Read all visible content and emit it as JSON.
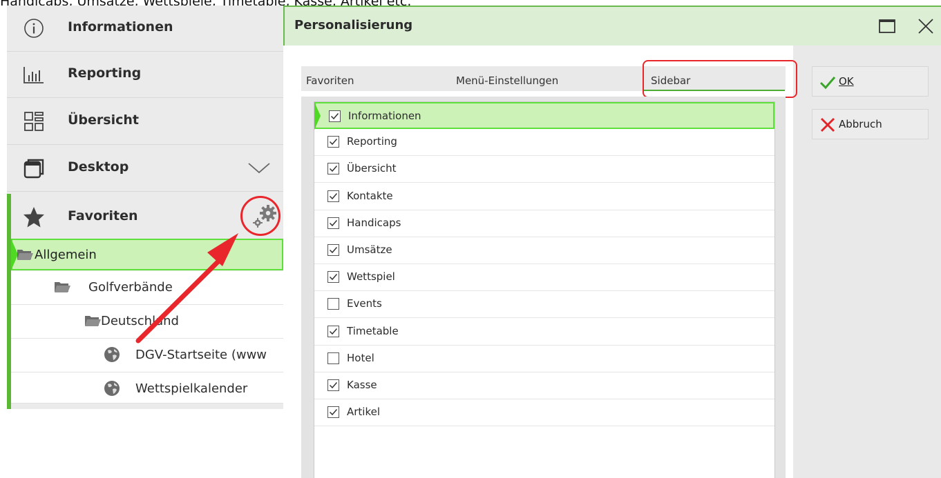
{
  "caption": "Handicaps, Umsätze, Wettspiele, Timetable, Kasse, Artikel etc.",
  "sidebar": {
    "items": [
      {
        "label": "Informationen",
        "icon": "info-icon"
      },
      {
        "label": "Reporting",
        "icon": "bar-chart-icon"
      },
      {
        "label": "Übersicht",
        "icon": "grid-layout-icon"
      },
      {
        "label": "Desktop",
        "icon": "window-icon"
      },
      {
        "label": "Favoriten",
        "icon": "star-icon"
      }
    ],
    "tree": [
      {
        "label": "Allgemein",
        "icon": "folder-icon",
        "selected": true
      },
      {
        "label": "Golfverbände",
        "icon": "folder-icon"
      },
      {
        "label": "Deutschland",
        "icon": "folder-icon"
      },
      {
        "label": "DGV-Startseite (www",
        "icon": "globe-icon"
      },
      {
        "label": "Wettspielkalender",
        "icon": "globe-icon"
      }
    ]
  },
  "dialog": {
    "title": "Personalisierung",
    "tabs": [
      {
        "label": "Favoriten",
        "active": false
      },
      {
        "label": "Menü-Einstellungen",
        "active": false
      },
      {
        "label": "Sidebar",
        "active": true
      }
    ],
    "list": [
      {
        "label": "Informationen",
        "checked": true,
        "selected": true
      },
      {
        "label": "Reporting",
        "checked": true
      },
      {
        "label": "Übersicht",
        "checked": true
      },
      {
        "label": "Kontakte",
        "checked": true
      },
      {
        "label": "Handicaps",
        "checked": true
      },
      {
        "label": "Umsätze",
        "checked": true
      },
      {
        "label": "Wettspiel",
        "checked": true
      },
      {
        "label": "Events",
        "checked": false
      },
      {
        "label": "Timetable",
        "checked": true
      },
      {
        "label": "Hotel",
        "checked": false
      },
      {
        "label": "Kasse",
        "checked": true
      },
      {
        "label": "Artikel",
        "checked": true
      }
    ],
    "buttons": {
      "ok_label": "OK",
      "cancel_label": "Abbruch"
    }
  },
  "colors": {
    "accent_green": "#5ab834",
    "highlight_red": "#e8262b",
    "selection_bg": "#ccf2b8"
  }
}
